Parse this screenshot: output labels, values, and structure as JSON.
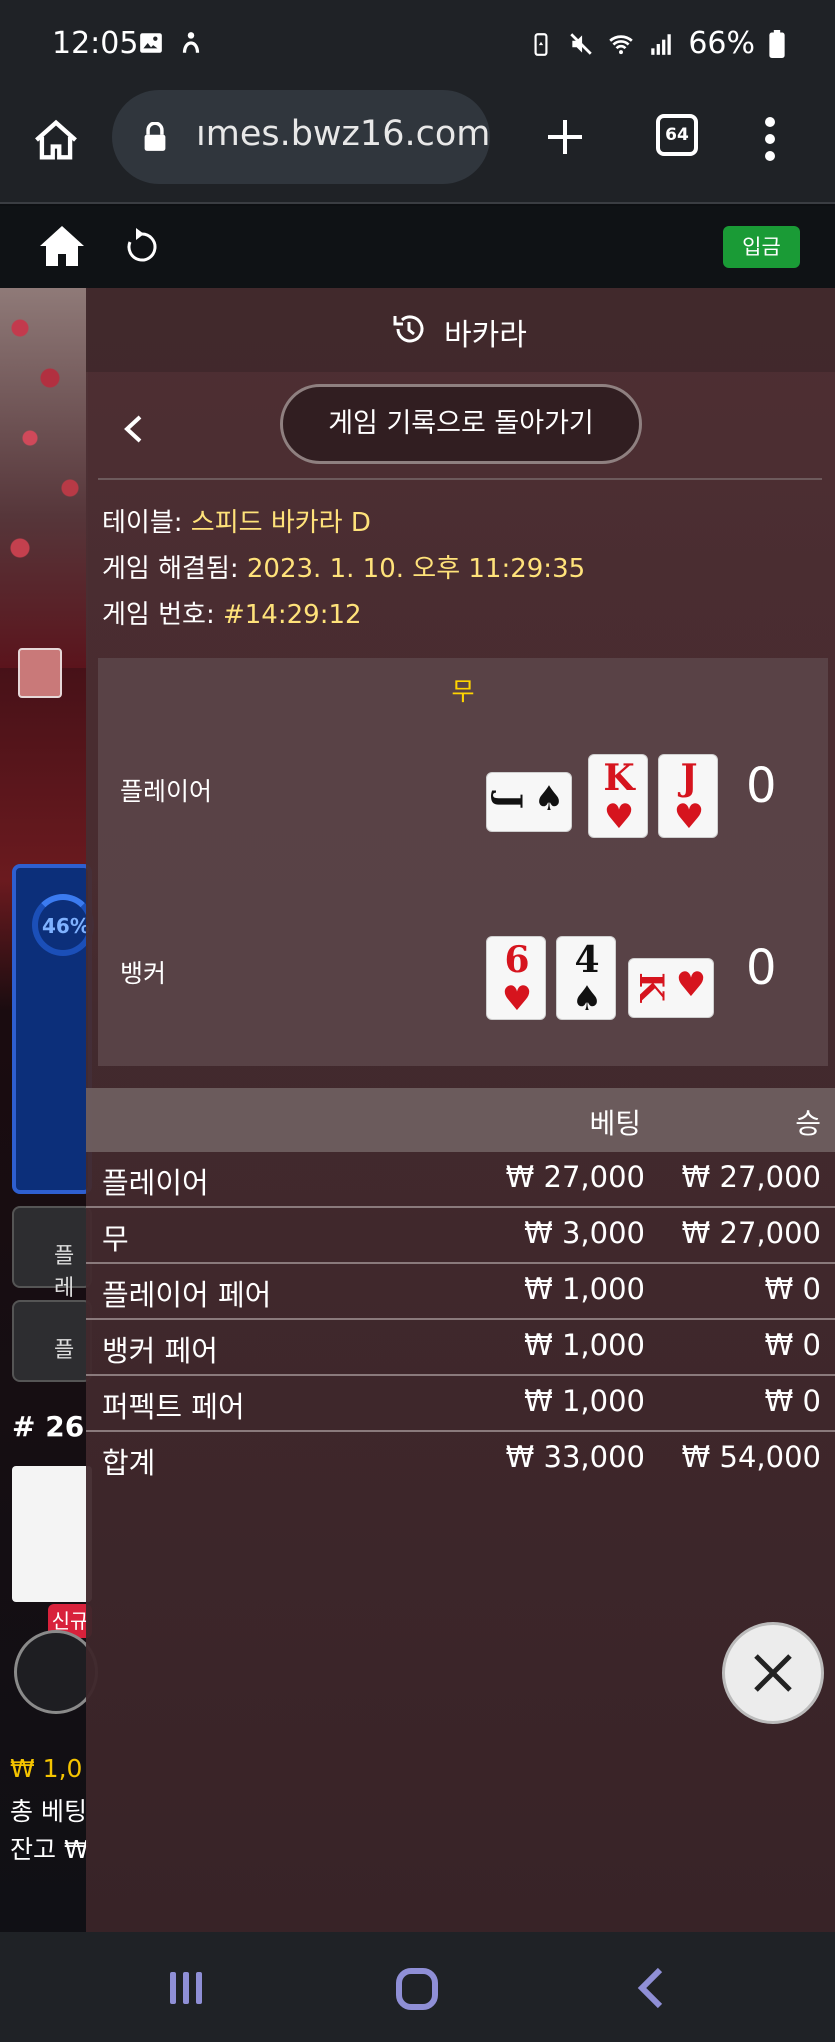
{
  "status_bar": {
    "time": "12:05",
    "battery": "66%"
  },
  "browser": {
    "url": "ımes.bwz16.com",
    "tab_count": "64"
  },
  "casino_bar": {
    "deposit_label": "입금"
  },
  "background_game": {
    "percent": "46%",
    "btn1": "플레",
    "btn2": "플",
    "round_number": "# 26",
    "new_badge": "신규",
    "balance": "₩ 1,0",
    "total_bet": "총 베팅",
    "cash": "잔고 ₩"
  },
  "panel": {
    "title": "바카라",
    "back_to_history": "게임 기록으로 돌아가기",
    "table_label": "테이블:",
    "table_value": "스피드 바카라 D",
    "resolved_label": "게임 해결됨:",
    "resolved_value": "2023. 1. 10. 오후 11:29:35",
    "game_no_label": "게임 번호:",
    "game_no_value": "#14:29:12",
    "result": "무",
    "player_label": "플레이어",
    "banker_label": "뱅커",
    "player_score": "0",
    "banker_score": "0",
    "player_cards": [
      {
        "rank": "J",
        "suit": "♠",
        "color": "black",
        "orientation": "horizontal"
      },
      {
        "rank": "K",
        "suit": "♥",
        "color": "red",
        "orientation": "vertical"
      },
      {
        "rank": "J",
        "suit": "♥",
        "color": "red",
        "orientation": "vertical"
      }
    ],
    "banker_cards": [
      {
        "rank": "6",
        "suit": "♥",
        "color": "red",
        "orientation": "vertical"
      },
      {
        "rank": "4",
        "suit": "♠",
        "color": "black",
        "orientation": "vertical"
      },
      {
        "rank": "K",
        "suit": "♥",
        "color": "red",
        "orientation": "horizontal"
      }
    ],
    "bets": {
      "header_bet": "베팅",
      "header_win": "승",
      "rows": [
        {
          "name": "플레이어",
          "bet": "₩ 27,000",
          "win": "₩ 27,000"
        },
        {
          "name": "무",
          "bet": "₩ 3,000",
          "win": "₩ 27,000"
        },
        {
          "name": "플레이어 페어",
          "bet": "₩ 1,000",
          "win": "₩ 0"
        },
        {
          "name": "뱅커 페어",
          "bet": "₩ 1,000",
          "win": "₩ 0"
        },
        {
          "name": "퍼펙트 페어",
          "bet": "₩ 1,000",
          "win": "₩ 0"
        },
        {
          "name": "합계",
          "bet": "₩ 33,000",
          "win": "₩ 54,000"
        }
      ]
    }
  }
}
